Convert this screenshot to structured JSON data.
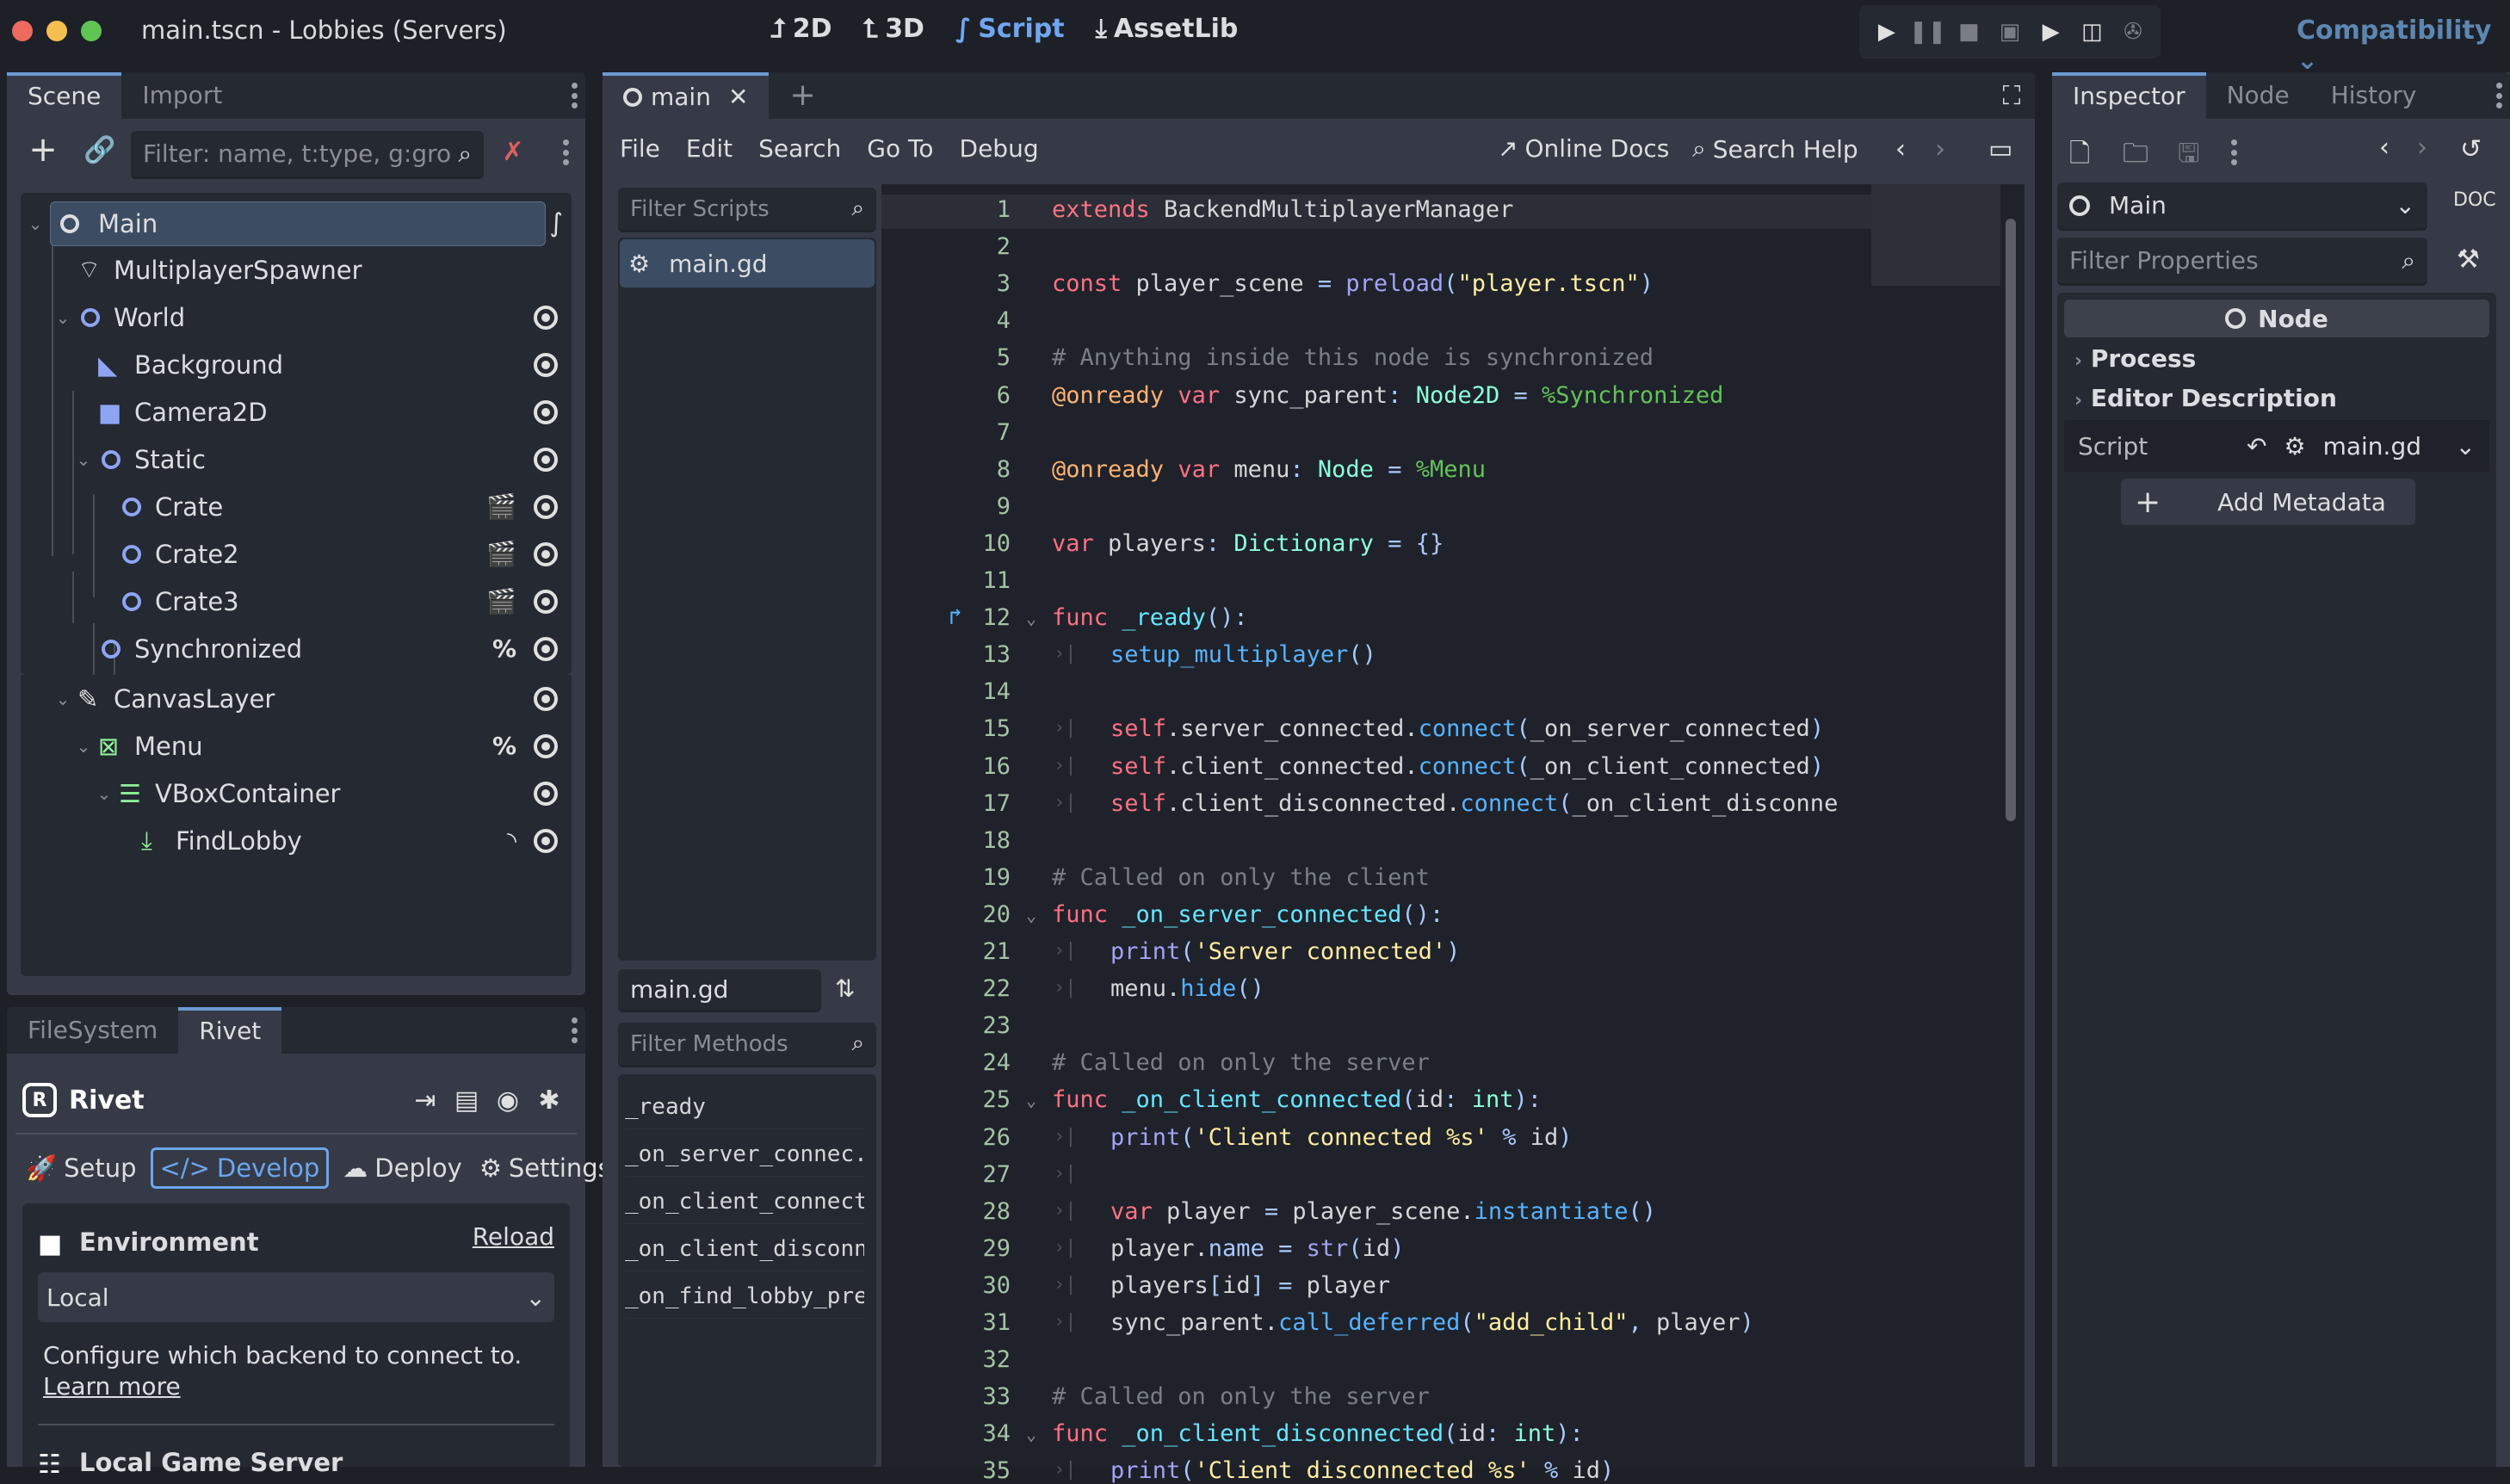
{
  "window": {
    "title": "main.tscn - Lobbies (Servers)",
    "modes": [
      {
        "label": "2D",
        "icon": "2d-icon",
        "active": false
      },
      {
        "label": "3D",
        "icon": "3d-icon",
        "active": false
      },
      {
        "label": "Script",
        "icon": "script-icon",
        "active": true
      },
      {
        "label": "AssetLib",
        "icon": "download-icon",
        "active": false
      }
    ],
    "run_controls": [
      "play-icon",
      "pause-icon",
      "stop-icon",
      "remote-debug-icon",
      "play-scene-icon",
      "play-custom-scene-icon",
      "movie-maker-icon"
    ],
    "renderer": "Compatibility",
    "accent": "#70a6f0"
  },
  "scene_dock": {
    "tabs": [
      "Scene",
      "Import"
    ],
    "active_tab": "Scene",
    "filter_placeholder": "Filter: name, t:type, g:gro",
    "nodes": [
      {
        "name": "Main",
        "depth": 0,
        "icon": "node-icon",
        "expanded": true,
        "selected": true,
        "badges": [
          "script-icon"
        ],
        "visible_toggle": false
      },
      {
        "name": "MultiplayerSpawner",
        "depth": 1,
        "icon": "multiplayer-spawner-icon",
        "badges": [],
        "visible_toggle": false
      },
      {
        "name": "World",
        "depth": 1,
        "icon": "node2d-icon",
        "expanded": true,
        "badges": [],
        "visible_toggle": true
      },
      {
        "name": "Background",
        "depth": 2,
        "icon": "polygon-icon",
        "badges": [],
        "visible_toggle": true
      },
      {
        "name": "Camera2D",
        "depth": 2,
        "icon": "camera-icon",
        "badges": [],
        "visible_toggle": true
      },
      {
        "name": "Static",
        "depth": 2,
        "icon": "node2d-icon",
        "expanded": true,
        "badges": [],
        "visible_toggle": true
      },
      {
        "name": "Crate",
        "depth": 3,
        "icon": "node2d-icon",
        "badges": [
          "instance-icon"
        ],
        "visible_toggle": true
      },
      {
        "name": "Crate2",
        "depth": 3,
        "icon": "node2d-icon",
        "badges": [
          "instance-icon"
        ],
        "visible_toggle": true
      },
      {
        "name": "Crate3",
        "depth": 3,
        "icon": "node2d-icon",
        "badges": [
          "instance-icon"
        ],
        "visible_toggle": true
      },
      {
        "name": "Synchronized",
        "depth": 2,
        "icon": "node2d-icon",
        "badges": [
          "%"
        ],
        "visible_toggle": true
      },
      {
        "name": "CanvasLayer",
        "depth": 1,
        "icon": "canvas-layer-icon",
        "expanded": true,
        "badges": [],
        "visible_toggle": true
      },
      {
        "name": "Menu",
        "depth": 2,
        "icon": "control-icon",
        "expanded": true,
        "badges": [
          "%"
        ],
        "visible_toggle": true
      },
      {
        "name": "VBoxContainer",
        "depth": 3,
        "icon": "vbox-icon",
        "expanded": true,
        "badges": [],
        "visible_toggle": true
      },
      {
        "name": "FindLobby",
        "depth": 4,
        "icon": "button-icon",
        "badges": [
          "signal-icon"
        ],
        "visible_toggle": true
      }
    ]
  },
  "bottom_dock": {
    "tabs": [
      "FileSystem",
      "Rivet"
    ],
    "active_tab": "Rivet",
    "rivet": {
      "title": "Rivet",
      "header_icons": [
        "login-icon",
        "docs-icon",
        "discord-icon",
        "bug-icon"
      ],
      "nav": [
        {
          "label": "Setup",
          "icon": "rocket-icon",
          "active": false
        },
        {
          "label": "Develop",
          "icon": "code-icon",
          "active": true
        },
        {
          "label": "Deploy",
          "icon": "cloud-upload-icon",
          "active": false
        },
        {
          "label": "Settings",
          "icon": "gear-icon",
          "active": false
        }
      ],
      "environment": {
        "heading": "Environment",
        "reload": "Reload",
        "selected": "Local",
        "description": "Configure which backend to connect to.",
        "learn_more": "Learn more"
      },
      "local_server_heading": "Local Game Server"
    }
  },
  "script_editor": {
    "tabs": [
      {
        "label": "main",
        "closable": true
      }
    ],
    "menu": [
      "File",
      "Edit",
      "Search",
      "Go To",
      "Debug"
    ],
    "online_docs": "Online Docs",
    "search_help": "Search Help",
    "filter_scripts_placeholder": "Filter Scripts",
    "scripts": [
      "main.gd"
    ],
    "current_script": "main.gd",
    "filter_methods_placeholder": "Filter Methods",
    "methods": [
      "_ready",
      "_on_server_connec...",
      "_on_client_connected",
      "_on_client_disconn...",
      "_on_find_lobby_pre..."
    ],
    "lines": [
      {
        "n": 1,
        "text": "extends BackendMultiplayerManager"
      },
      {
        "n": 2,
        "text": ""
      },
      {
        "n": 3,
        "text": "const player_scene = preload(\"player.tscn\")"
      },
      {
        "n": 4,
        "text": ""
      },
      {
        "n": 5,
        "text": "# Anything inside this node is synchronized"
      },
      {
        "n": 6,
        "text": "@onready var sync_parent: Node2D = %Synchronized"
      },
      {
        "n": 7,
        "text": ""
      },
      {
        "n": 8,
        "text": "@onready var menu: Node = %Menu"
      },
      {
        "n": 9,
        "text": ""
      },
      {
        "n": 10,
        "text": "var players: Dictionary = {}"
      },
      {
        "n": 11,
        "text": ""
      },
      {
        "n": 12,
        "text": "func _ready():"
      },
      {
        "n": 13,
        "text": "\tsetup_multiplayer()"
      },
      {
        "n": 14,
        "text": ""
      },
      {
        "n": 15,
        "text": "\tself.server_connected.connect(_on_server_connected)"
      },
      {
        "n": 16,
        "text": "\tself.client_connected.connect(_on_client_connected)"
      },
      {
        "n": 17,
        "text": "\tself.client_disconnected.connect(_on_client_disconne"
      },
      {
        "n": 18,
        "text": ""
      },
      {
        "n": 19,
        "text": "# Called on only the client"
      },
      {
        "n": 20,
        "text": "func _on_server_connected():"
      },
      {
        "n": 21,
        "text": "\tprint('Server connected')"
      },
      {
        "n": 22,
        "text": "\tmenu.hide()"
      },
      {
        "n": 23,
        "text": ""
      },
      {
        "n": 24,
        "text": "# Called on only the server"
      },
      {
        "n": 25,
        "text": "func _on_client_connected(id: int):"
      },
      {
        "n": 26,
        "text": "\tprint('Client connected %s' % id)"
      },
      {
        "n": 27,
        "text": "\t"
      },
      {
        "n": 28,
        "text": "\tvar player = player_scene.instantiate()"
      },
      {
        "n": 29,
        "text": "\tplayer.name = str(id)"
      },
      {
        "n": 30,
        "text": "\tplayers[id] = player"
      },
      {
        "n": 31,
        "text": "\tsync_parent.call_deferred(\"add_child\", player)"
      },
      {
        "n": 32,
        "text": ""
      },
      {
        "n": 33,
        "text": "# Called on only the server"
      },
      {
        "n": 34,
        "text": "func _on_client_disconnected(id: int):"
      },
      {
        "n": 35,
        "text": "\tprint('Client disconnected %s' % id)"
      }
    ]
  },
  "inspector": {
    "tabs": [
      "Inspector",
      "Node",
      "History"
    ],
    "active_tab": "Inspector",
    "object": "Main",
    "filter_placeholder": "Filter Properties",
    "class_header": "Node",
    "sections": [
      "Process",
      "Editor Description"
    ],
    "script_label": "Script",
    "script_value": "main.gd",
    "add_metadata": "Add Metadata"
  }
}
